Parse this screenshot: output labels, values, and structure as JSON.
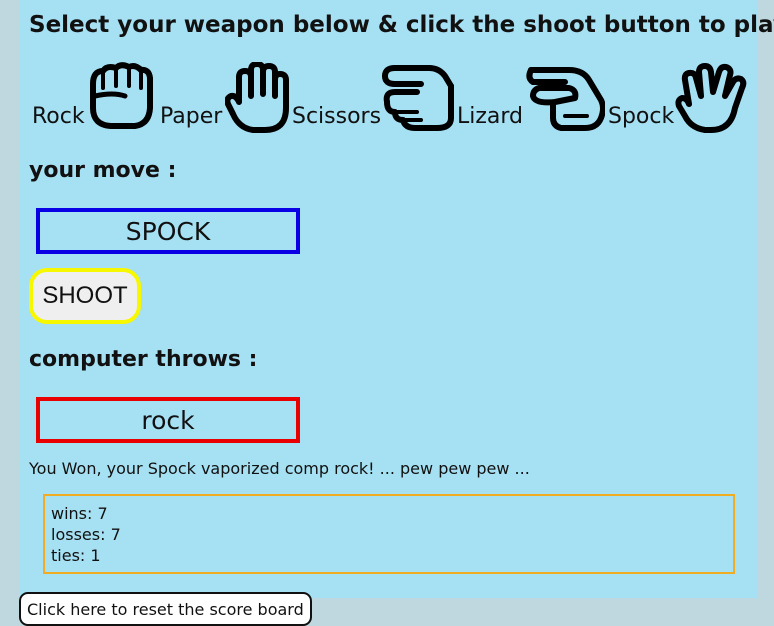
{
  "header": {
    "instructions": "Select your weapon below & click the shoot button to play"
  },
  "weapons": [
    {
      "label": "Rock",
      "icon": "fist-icon"
    },
    {
      "label": "Paper",
      "icon": "raised-hand-icon"
    },
    {
      "label": "Scissors",
      "icon": "scissors-hand-icon"
    },
    {
      "label": "Lizard",
      "icon": "lizard-hand-icon"
    },
    {
      "label": "Spock",
      "icon": "vulcan-salute-icon"
    }
  ],
  "player": {
    "label": "your move :",
    "move": "SPOCK",
    "border_color": "#0a00e6"
  },
  "shoot": {
    "label": "SHOOT",
    "border_color": "#f7f700"
  },
  "computer": {
    "label": "computer throws :",
    "move": "rock",
    "border_color": "#e80000"
  },
  "result": {
    "message": "You Won, your Spock vaporized comp rock! ... pew pew pew ..."
  },
  "scoreboard": {
    "wins": "wins: 7",
    "losses": "losses: 7",
    "ties": "ties: 1",
    "border_color": "#f0ad24"
  },
  "reset": {
    "label": "Click here to reset the score board"
  },
  "colors": {
    "panel_bg": "#a6e0f3",
    "page_bg": "#bfd8df"
  }
}
